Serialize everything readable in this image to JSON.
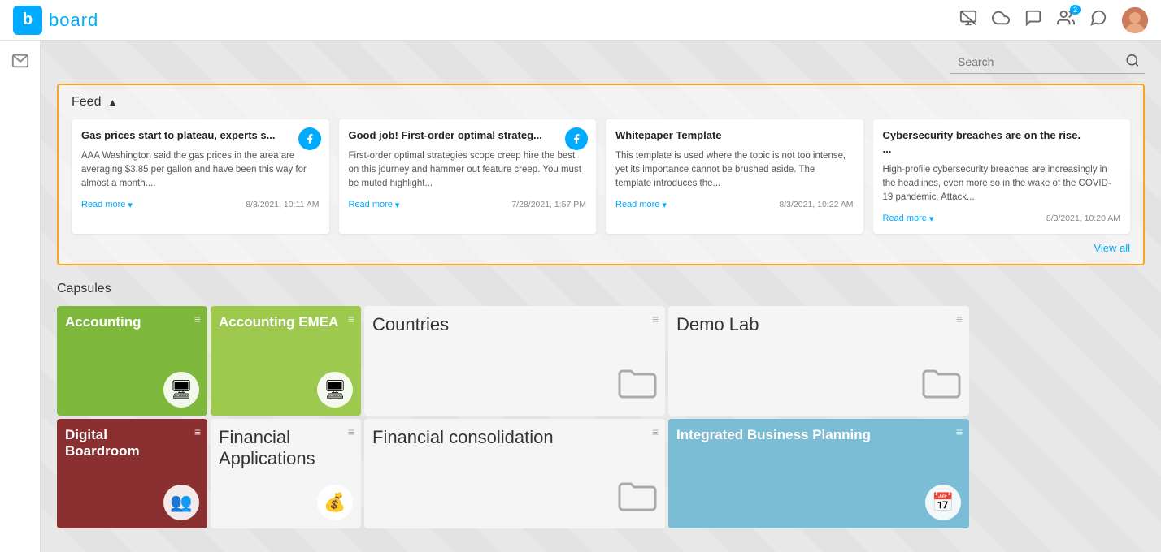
{
  "topnav": {
    "logo_letter": "b",
    "brand": "board",
    "badge_count": "2"
  },
  "search": {
    "placeholder": "Search"
  },
  "feed": {
    "title": "Feed",
    "view_all": "View all",
    "cards": [
      {
        "title": "Gas prices start to plateau, experts s...",
        "body": "AAA Washington said the gas prices in the area are averaging $3.85 per gallon and have been this way for almost a month....",
        "read_more": "Read more",
        "date": "8/3/2021, 10:11 AM",
        "has_icon": true
      },
      {
        "title": "Good job! First-order optimal strateg...",
        "body": "First-order optimal strategies scope creep hire the best on this journey and hammer out feature creep. You must be muted highlight...",
        "read_more": "Read more",
        "date": "7/28/2021, 1:57 PM",
        "has_icon": true
      },
      {
        "title": "Whitepaper Template",
        "body": "This template is used where the topic is not too intense, yet its importance cannot be brushed aside. The template introduces the...",
        "read_more": "Read more",
        "date": "8/3/2021, 10:22 AM",
        "has_icon": false
      },
      {
        "title": "Cybersecurity breaches are on the rise. ...",
        "body": "High-profile cybersecurity breaches are increasingly in the headlines, even more so in the wake of the COVID-19 pandemic. Attack...",
        "read_more": "Read more",
        "date": "8/3/2021, 10:20 AM",
        "has_icon": false
      }
    ]
  },
  "capsules": {
    "title": "Capsules",
    "items": [
      {
        "id": "accounting",
        "name": "Accounting",
        "color_class": "cap-accounting",
        "icon": "🖥",
        "has_icon": true,
        "name_color": "white"
      },
      {
        "id": "accounting-emea",
        "name": "Accounting EMEA",
        "color_class": "cap-accounting-emea",
        "icon": "🖥",
        "has_icon": true,
        "name_color": "white"
      },
      {
        "id": "countries",
        "name": "Countries",
        "color_class": "cap-countries",
        "icon": "folder",
        "has_icon": false,
        "name_color": "dark"
      },
      {
        "id": "demolab",
        "name": "Demo Lab",
        "color_class": "cap-demolab",
        "icon": "folder",
        "has_icon": false,
        "name_color": "dark"
      },
      {
        "id": "digital-boardroom",
        "name": "Digital Boardroom",
        "color_class": "cap-digital-boardroom",
        "icon": "👥",
        "has_icon": true,
        "name_color": "white"
      },
      {
        "id": "financial-apps",
        "name": "Financial Applications",
        "color_class": "cap-financial-apps",
        "icon": "💰",
        "has_icon": true,
        "name_color": "dark"
      },
      {
        "id": "financial-con",
        "name": "Financial consolidation",
        "color_class": "cap-financial-con",
        "icon": "folder",
        "has_icon": false,
        "name_color": "dark"
      },
      {
        "id": "ibp",
        "name": "Integrated Business Planning",
        "color_class": "cap-ibp",
        "icon": "📅",
        "has_icon": true,
        "name_color": "white"
      }
    ]
  }
}
